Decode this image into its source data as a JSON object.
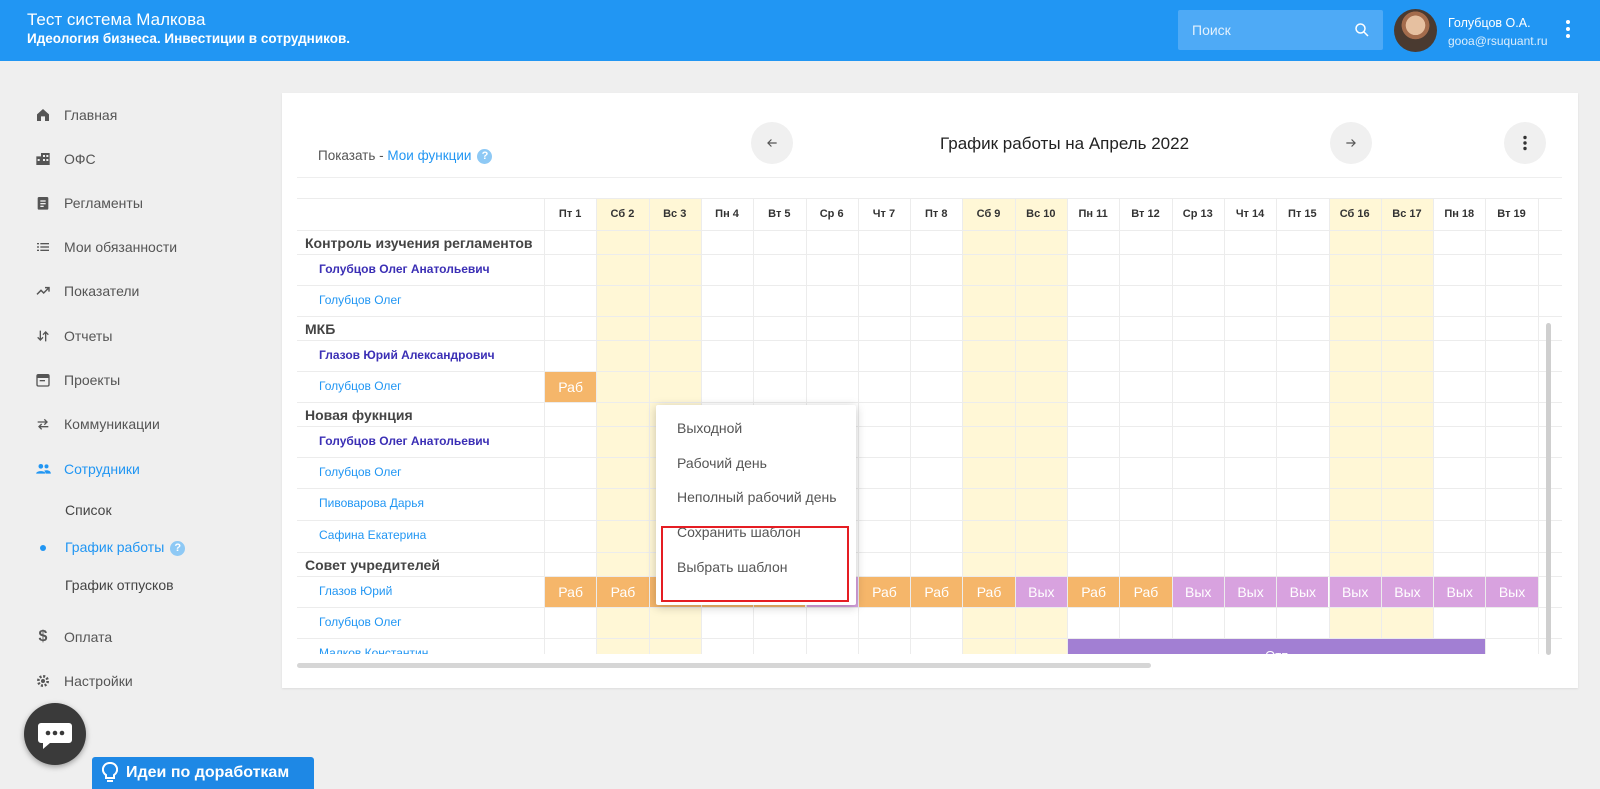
{
  "header": {
    "title": "Тест система Малкова",
    "subtitle": "Идеология бизнеса. Инвестиции в сотрудников.",
    "search_placeholder": "Поиск",
    "user_name": "Голубцов О.А.",
    "user_email": "gooa@rsuquant.ru"
  },
  "sidebar": {
    "items": [
      {
        "label": "Главная",
        "icon": "home-icon"
      },
      {
        "label": "ОФС",
        "icon": "building-icon"
      },
      {
        "label": "Регламенты",
        "icon": "clipboard-icon"
      },
      {
        "label": "Мои обязанности",
        "icon": "list-icon"
      },
      {
        "label": "Показатели",
        "icon": "trending-icon"
      },
      {
        "label": "Отчеты",
        "icon": "swap-vertical-icon"
      },
      {
        "label": "Проекты",
        "icon": "calendar-icon"
      },
      {
        "label": "Коммуникации",
        "icon": "swap-horizontal-icon"
      },
      {
        "label": "Сотрудники",
        "icon": "people-icon"
      }
    ],
    "sub_items": [
      "Список",
      "График работы",
      "График отпусков"
    ],
    "bottom_items": [
      {
        "label": "Оплата",
        "icon": "dollar-icon"
      },
      {
        "label": "Настройки",
        "icon": "gear-icon"
      }
    ]
  },
  "ideas_label": "Идеи по доработкам",
  "schedule": {
    "show_label": "Показать - ",
    "show_link": "Мои функции",
    "title": "График работы на Апрель 2022",
    "days": [
      "Пт 1",
      "Сб 2",
      "Вс 3",
      "Пн 4",
      "Вт 5",
      "Ср 6",
      "Чт 7",
      "Пт 8",
      "Сб 9",
      "Вс 10",
      "Пн 11",
      "Вт 12",
      "Ср 13",
      "Чт 14",
      "Пт 15",
      "Сб 16",
      "Вс 17",
      "Пн 18",
      "Вт 19"
    ],
    "weekend_indices": [
      1,
      2,
      8,
      9,
      15,
      16
    ],
    "groups": [
      {
        "name": "Контроль изучения регламентов",
        "people": [
          {
            "name": "Голубцов Олег Анатольевич",
            "head": true
          },
          {
            "name": "Голубцов Олег"
          }
        ]
      },
      {
        "name": "МКБ",
        "people": [
          {
            "name": "Глазов Юрий Александрович",
            "head": true
          },
          {
            "name": "Голубцов Олег"
          }
        ]
      },
      {
        "name": "Новая фукнция",
        "people": [
          {
            "name": "Голубцов Олег Анатольевич",
            "head": true
          },
          {
            "name": "Голубцов Олег"
          },
          {
            "name": "Пивоварова Дарья"
          },
          {
            "name": "Сафина Екатерина"
          }
        ]
      },
      {
        "name": "Совет учредителей",
        "people": [
          {
            "name": "Глазов Юрий"
          },
          {
            "name": "Голубцов Олег"
          },
          {
            "name": "Малков Константин"
          }
        ]
      }
    ],
    "work_label": "Раб",
    "off_label": "Вых",
    "vacation_label": "Отп",
    "glazov_row": [
      "Раб",
      "Раб",
      "Раб",
      "Раб",
      "Раб",
      "Вых",
      "Раб",
      "Раб",
      "Раб",
      "Вых",
      "Раб",
      "Раб",
      "Вых",
      "Вых",
      "Вых",
      "Вых",
      "Вых",
      "Вых",
      "Вых"
    ]
  },
  "context_menu": {
    "items": [
      "Выходной",
      "Рабочий день",
      "Неполный рабочий день",
      "Сохранить шаблон",
      "Выбрать шаблон"
    ]
  }
}
